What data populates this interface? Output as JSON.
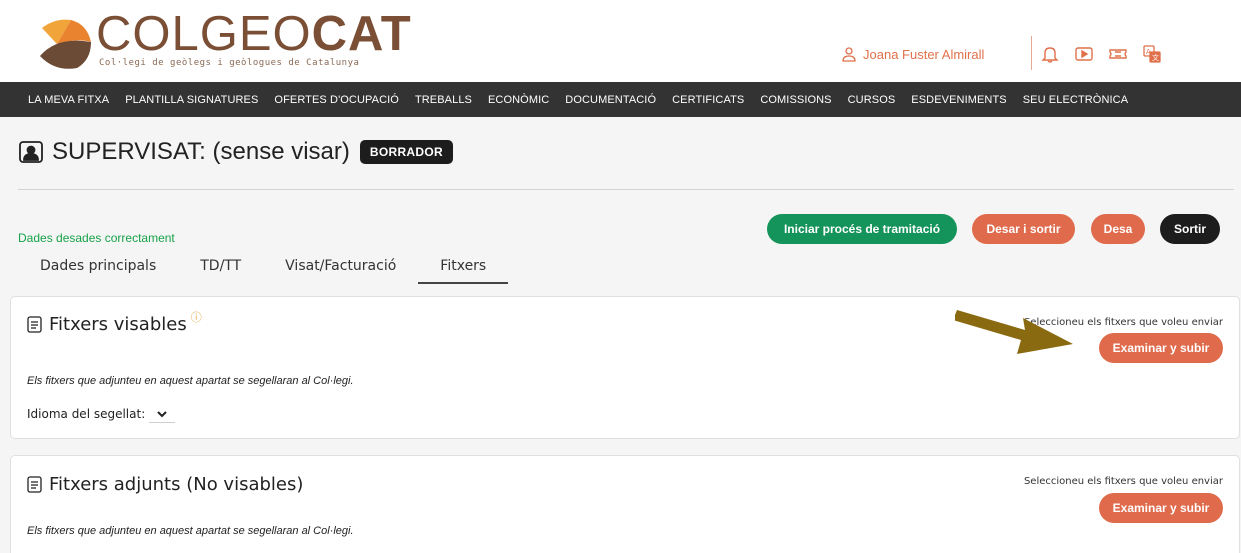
{
  "header": {
    "logo_text_light": "COLGEO",
    "logo_text_bold": "CAT",
    "logo_subtitle": "Col·legi de geòlegs i geòlogues de Catalunya",
    "user_name": "Joana Fuster Almirall",
    "icons": [
      "user-icon",
      "bell-icon",
      "video-icon",
      "ticket-icon",
      "translate-icon"
    ]
  },
  "nav": {
    "items": [
      "LA MEVA FITXA",
      "PLANTILLA SIGNATURES",
      "OFERTES D'OCUPACIÓ",
      "TREBALLS",
      "ECONÒMIC",
      "DOCUMENTACIÓ",
      "CERTIFICATS",
      "COMISSIONS",
      "CURSOS",
      "ESDEVENIMENTS",
      "SEU ELECTRÒNICA"
    ]
  },
  "page": {
    "title": "SUPERVISAT: (sense visar)",
    "badge": "BORRADOR",
    "saved_message": "Dades desades correctament"
  },
  "actions": {
    "start": "Iniciar procés de tramitació",
    "save_exit": "Desar i sortir",
    "save": "Desa",
    "exit": "Sortir"
  },
  "tabs": [
    {
      "label": "Dades principals",
      "active": false
    },
    {
      "label": "TD/TT",
      "active": false
    },
    {
      "label": "Visat/Facturació",
      "active": false
    },
    {
      "label": "Fitxers",
      "active": true
    }
  ],
  "panel_visable": {
    "title": "Fitxers visables",
    "info": "ⓘ",
    "select_label": "Seleccioneu els fitxers que voleu enviar",
    "upload_label": "Examinar y subir",
    "note": "Els fitxers que adjunteu en aquest apartat se segellaran al Col·legi.",
    "language_label": "Idioma del segellat:"
  },
  "panel_adjunts": {
    "title": "Fitxers adjunts (No visables)",
    "select_label": "Seleccioneu els fitxers que voleu enviar",
    "upload_label": "Examinar y subir",
    "note": "Els fitxers que adjunteu en aquest apartat se segellaran al Col·legi."
  },
  "colors": {
    "brand_brown": "#7a4f35",
    "accent_orange": "#e06a4c",
    "success_green": "#14935a",
    "nav_bg": "#333333",
    "annotation_arrow": "#8a6a10"
  }
}
